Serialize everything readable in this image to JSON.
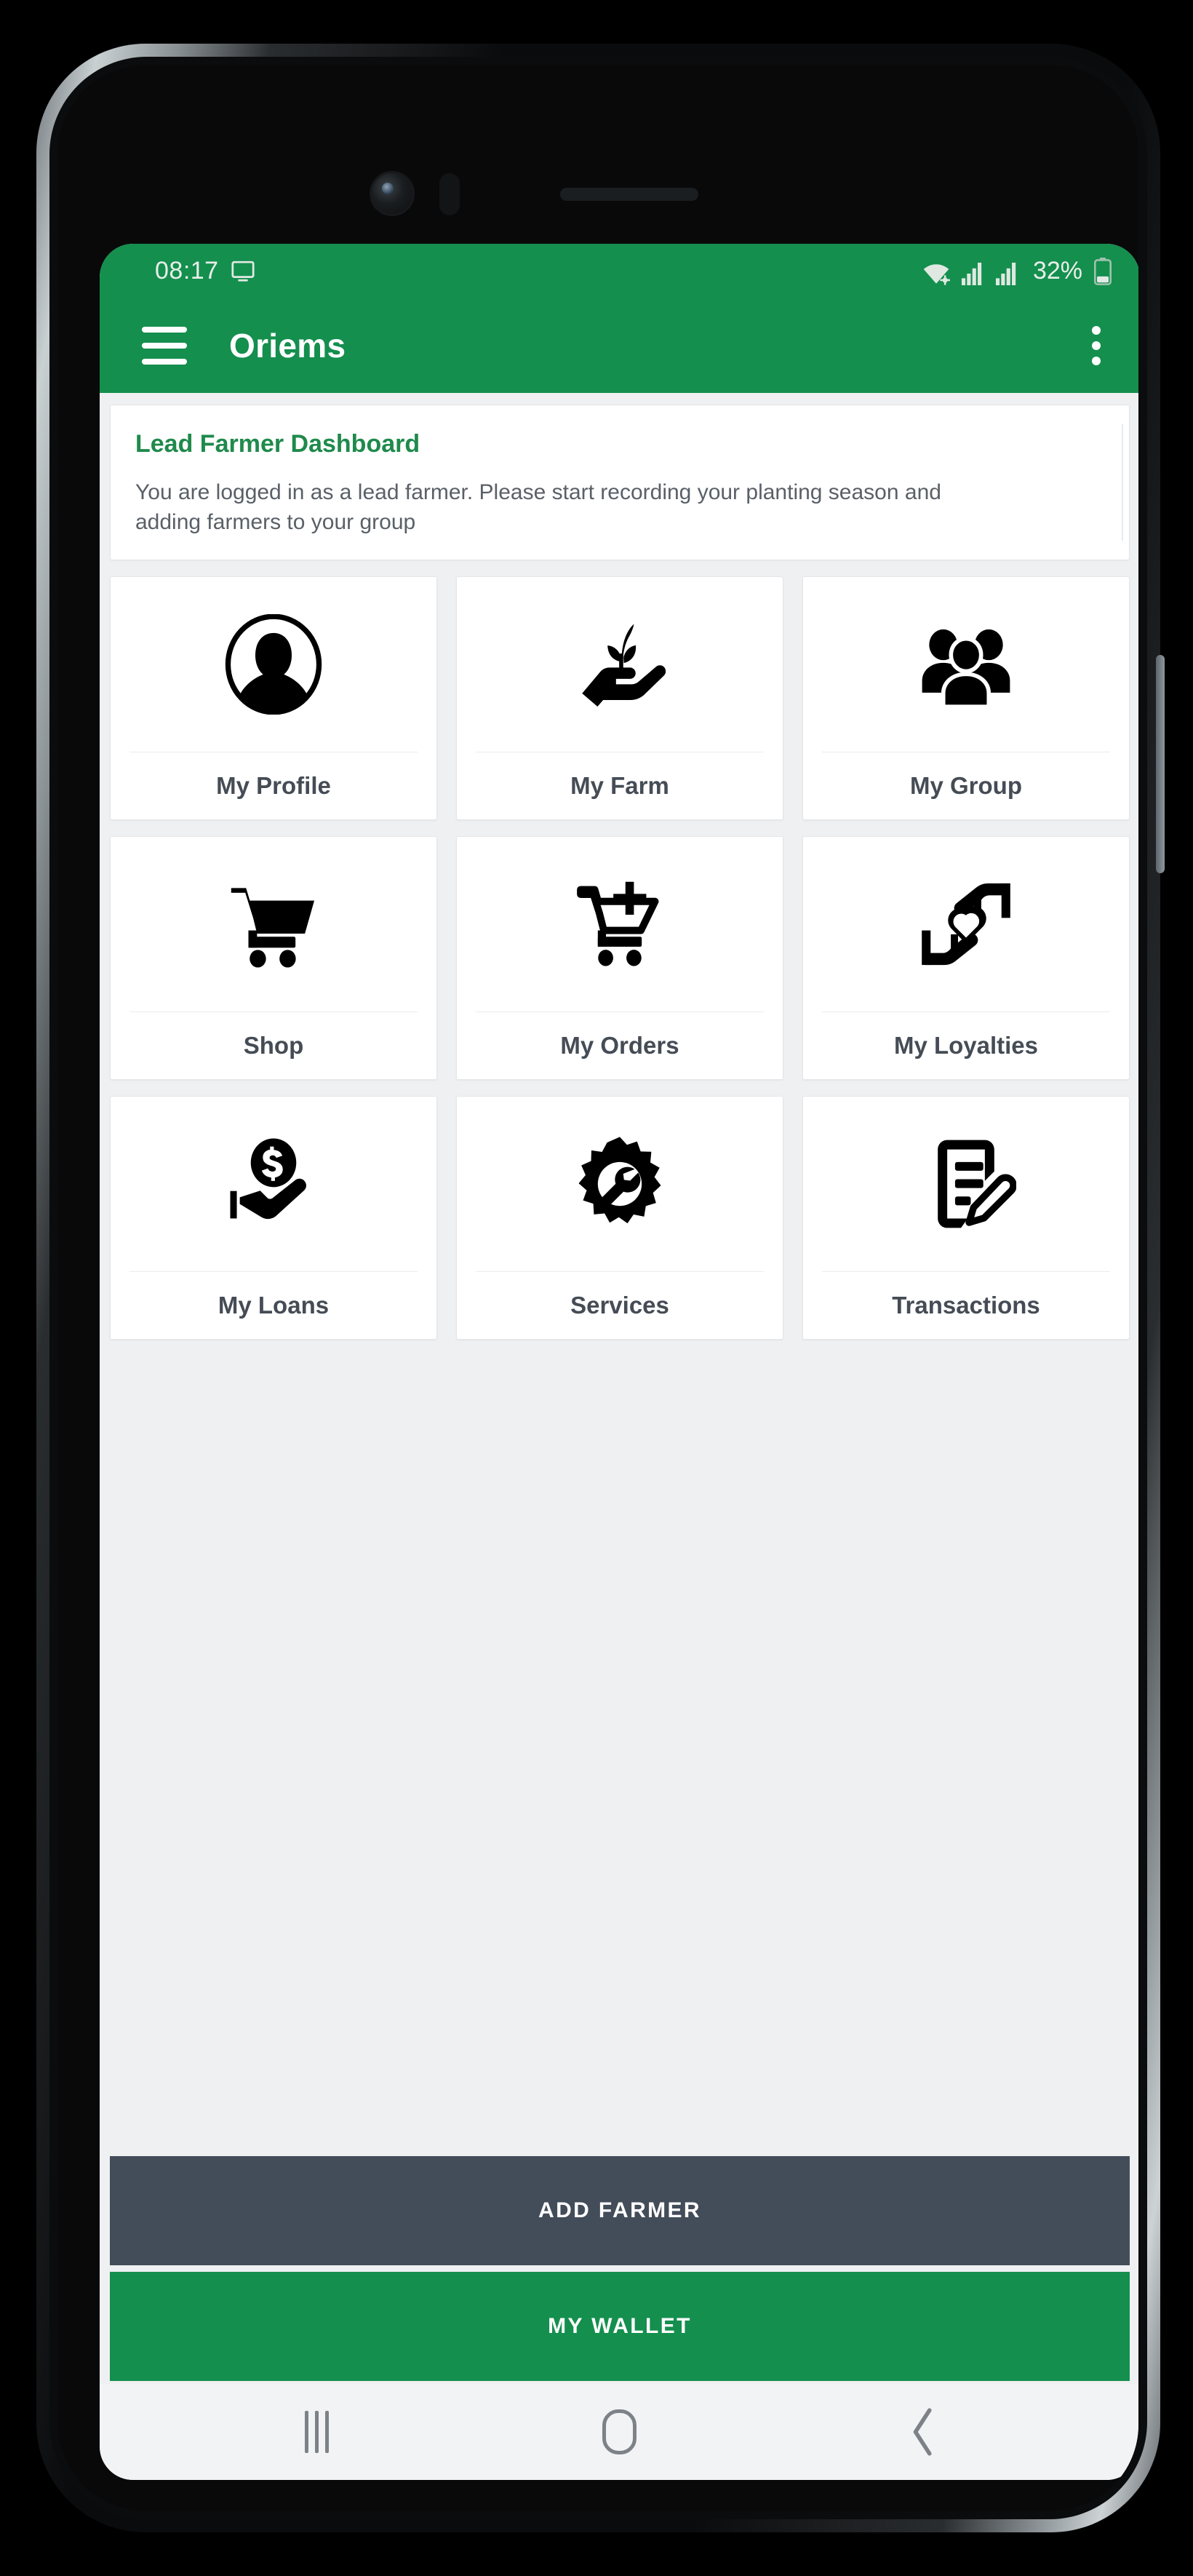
{
  "status_bar": {
    "time": "08:17",
    "screen_cast_icon": "monitor-icon",
    "wifi_icon": "wifi-icon",
    "signal_icon_1": "signal-bars-icon",
    "signal_icon_2": "signal-bars-icon",
    "battery_percent": "32%",
    "battery_icon": "battery-low-icon"
  },
  "app_bar": {
    "menu_icon": "hamburger-menu-icon",
    "title": "Oriems",
    "overflow_icon": "more-vertical-icon"
  },
  "dashboard_card": {
    "title": "Lead Farmer Dashboard",
    "body": "You are logged in as a lead farmer. Please start recording your planting season and adding farmers to your group"
  },
  "tiles": [
    {
      "label": "My Profile",
      "icon": "user-avatar-icon"
    },
    {
      "label": "My Farm",
      "icon": "hand-holding-plant-icon"
    },
    {
      "label": "My Group",
      "icon": "people-group-icon"
    },
    {
      "label": "Shop",
      "icon": "shopping-cart-icon"
    },
    {
      "label": "My Orders",
      "icon": "cart-plus-icon"
    },
    {
      "label": "My Loyalties",
      "icon": "hands-heart-icon"
    },
    {
      "label": "My Loans",
      "icon": "hand-holding-coin-icon"
    },
    {
      "label": "Services",
      "icon": "gear-wrench-icon"
    },
    {
      "label": "Transactions",
      "icon": "document-edit-icon"
    }
  ],
  "bottom_actions": {
    "add_farmer": "ADD FARMER",
    "my_wallet": "MY WALLET"
  },
  "nav_bar": {
    "recents": "recents-icon",
    "home": "home-icon",
    "back": "back-chevron-icon"
  },
  "colors": {
    "brand_green": "#148F4E",
    "dark_slate": "#434C59",
    "page_background": "#EFF0F2",
    "card_white": "#FFFFFF",
    "title_green": "#1F8A4C",
    "label_gray": "#454C55"
  }
}
